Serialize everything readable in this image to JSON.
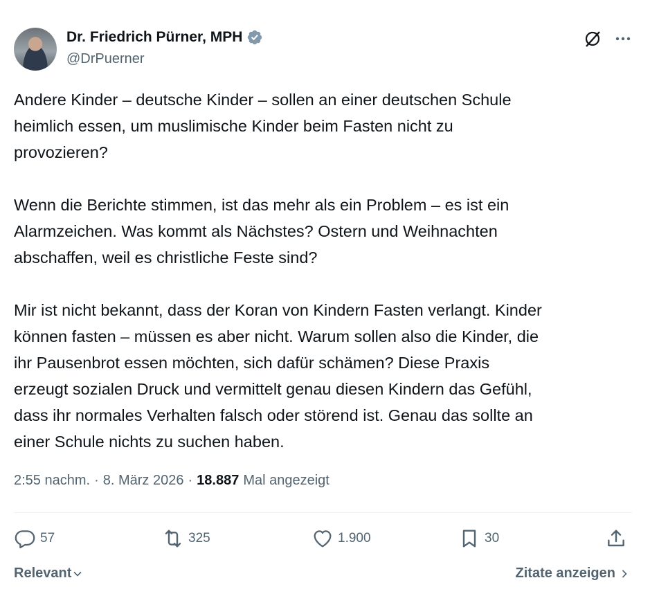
{
  "author": {
    "name": "Dr. Friedrich Pürner, MPH",
    "handle": "@DrPuerner"
  },
  "post": {
    "paragraphs": [
      "Andere Kinder – deutsche Kinder – sollen an einer deutschen Schule\nheimlich essen, um muslimische Kinder beim Fasten nicht zu\nprovozieren?",
      "Wenn die Berichte stimmen, ist das mehr als ein Problem – es ist ein\nAlarmzeichen. Was kommt als Nächstes? Ostern und Weihnachten\nabschaffen, weil es christliche Feste sind?",
      "Mir ist nicht bekannt, dass der Koran von Kindern Fasten verlangt. Kinder\nkönnen fasten – müssen es aber nicht. Warum sollen also die Kinder, die\nihr Pausenbrot essen möchten, sich dafür schämen? Diese Praxis\nerzeugt sozialen Druck und vermittelt genau diesen Kindern das Gefühl,\ndass ihr normales Verhalten falsch oder störend ist. Genau das sollte an\neiner Schule nichts zu suchen haben."
    ]
  },
  "meta": {
    "time": "2:55 nachm.",
    "sep1": "·",
    "date": "8. März 2026",
    "sep2": "·",
    "views": "18.887",
    "views_label": "Mal angezeigt"
  },
  "actions": {
    "replies": "57",
    "reposts": "325",
    "likes": "1.900",
    "bookmarks": "30"
  },
  "footer": {
    "sort_label": "Relevant",
    "quotes_label": "Zitate anzeigen"
  },
  "icons": [
    "verified-badge-icon",
    "grok-icon",
    "more-icon",
    "reply-icon",
    "repost-icon",
    "like-icon",
    "bookmark-icon",
    "share-icon",
    "chevron-down-icon",
    "chevron-right-icon"
  ],
  "colors": {
    "text": "#0f1419",
    "secondary": "#536471",
    "verified": "#829aab",
    "divider": "#eff3f4"
  }
}
